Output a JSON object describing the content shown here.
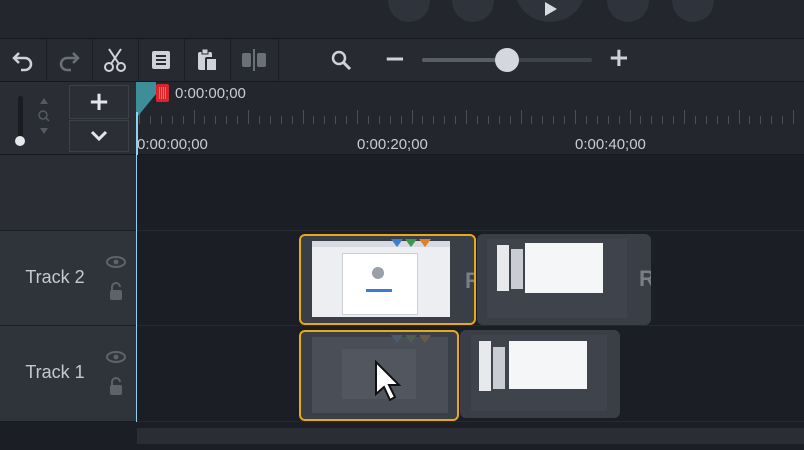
{
  "toolbar": {
    "buttons": [
      "undo-icon",
      "redo-icon",
      "cut-icon",
      "copy-icon",
      "paste-icon",
      "split-icon"
    ],
    "zoom_out": "−",
    "zoom_in": "+",
    "zoom_level": 0.5
  },
  "header": {
    "add_track": "+",
    "collapse": "⌄",
    "playhead_time": "0:00:00;00"
  },
  "ruler": {
    "labels": [
      "0:00:00;00",
      "0:00:20;00",
      "0:00:40;00"
    ]
  },
  "tracks": [
    {
      "name": "Track 2"
    },
    {
      "name": "Track 1"
    }
  ],
  "clips": {
    "track2_clip2_label": "R",
    "track2_clip1_label": "R"
  },
  "colors": {
    "selection": "#e8a916",
    "playhead": "#8fd1f0",
    "playhead_handle": "#3e8e9a",
    "marker": "#d9262c"
  }
}
